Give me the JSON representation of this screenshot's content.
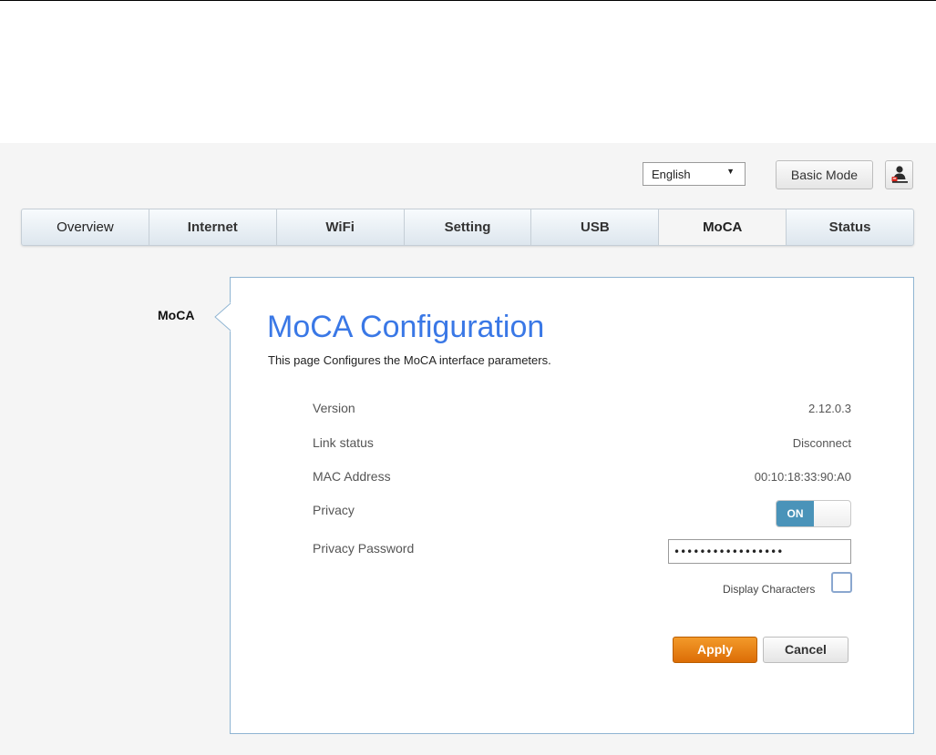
{
  "header": {
    "language": "English",
    "basic_mode_label": "Basic Mode",
    "user_icon": "user-icon"
  },
  "tabs": [
    {
      "label": "Overview"
    },
    {
      "label": "Internet"
    },
    {
      "label": "WiFi"
    },
    {
      "label": "Setting"
    },
    {
      "label": "USB"
    },
    {
      "label": "MoCA",
      "active": true
    },
    {
      "label": "Status"
    }
  ],
  "sidebar": {
    "items": [
      {
        "label": "MoCA",
        "active": true
      }
    ]
  },
  "page": {
    "title": "MoCA Configuration",
    "subtitle": "This page Configures the MoCA interface parameters."
  },
  "fields": {
    "version": {
      "label": "Version",
      "value": "2.12.0.3"
    },
    "link_status": {
      "label": "Link status",
      "value": "Disconnect"
    },
    "mac_address": {
      "label": "MAC Address",
      "value": "00:10:18:33:90:A0"
    },
    "privacy": {
      "label": "Privacy",
      "state": "ON"
    },
    "privacy_password": {
      "label": "Privacy Password",
      "value": "•••••••••••••••••"
    },
    "display_characters": {
      "label": "Display Characters",
      "checked": false
    }
  },
  "buttons": {
    "apply": "Apply",
    "cancel": "Cancel"
  },
  "colors": {
    "title": "#3a78e6",
    "toggle_on": "#4a93b9",
    "apply": "#e67e10",
    "panel_border": "#8fb4d2"
  }
}
